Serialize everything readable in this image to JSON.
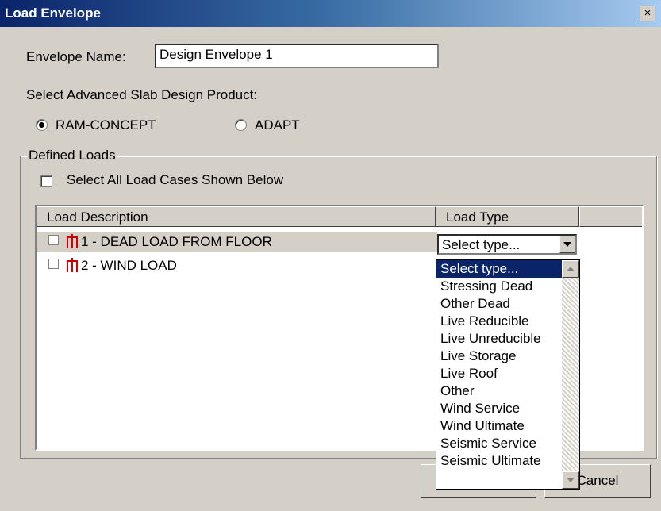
{
  "window": {
    "title": "Load Envelope",
    "close_label": "×"
  },
  "form": {
    "envelope_name_label": "Envelope Name:",
    "envelope_name_value": "Design Envelope 1",
    "product_label": "Select Advanced Slab Design Product:",
    "products": [
      {
        "label": "RAM-CONCEPT",
        "selected": true
      },
      {
        "label": "ADAPT",
        "selected": false
      }
    ]
  },
  "defined_loads": {
    "group_label": "Defined Loads",
    "select_all_label": "Select All Load Cases Shown Below",
    "columns": [
      "Load Description",
      "Load Type"
    ],
    "rows": [
      {
        "description": "1 - DEAD LOAD FROM FLOOR",
        "checked": false
      },
      {
        "description": "2 - WIND LOAD",
        "checked": false
      }
    ],
    "combo_value": "Select type...",
    "type_options": [
      "Select type...",
      "Stressing Dead",
      "Other Dead",
      "Live Reducible",
      "Live Unreducible",
      "Live Storage",
      "Live Roof",
      "Other",
      "Wind Service",
      "Wind Ultimate",
      "Seismic Service",
      "Seismic Ultimate"
    ]
  },
  "buttons": {
    "ok_label": "",
    "cancel_label": "Cancel"
  }
}
